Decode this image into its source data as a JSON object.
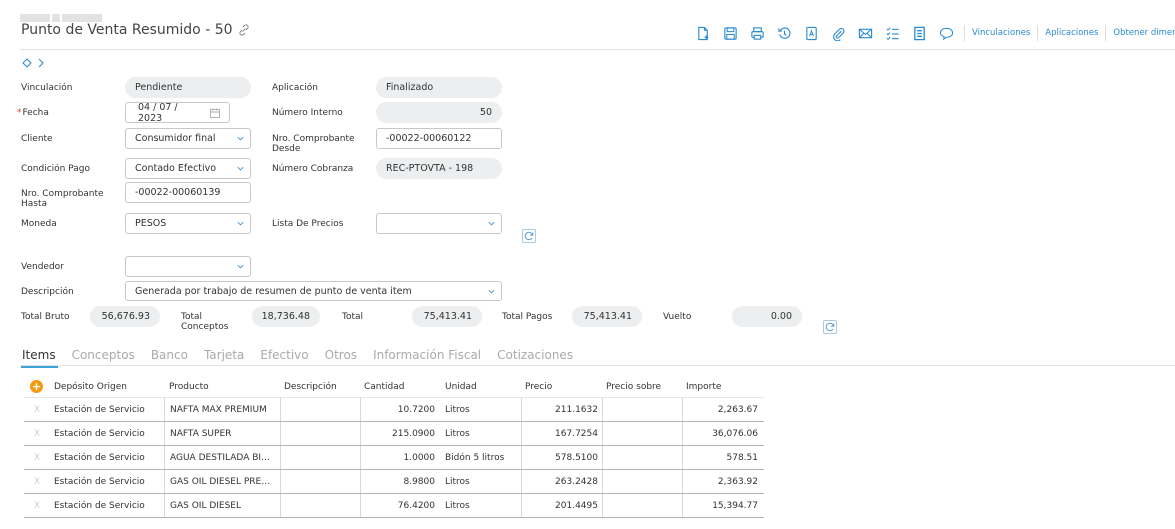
{
  "header": {
    "title": "Punto de Venta Resumido - 50",
    "toolbar_links": [
      "Vinculaciones",
      "Aplicaciones",
      "Obtener dimensiones"
    ]
  },
  "form": {
    "vinculacion": {
      "label": "Vinculación",
      "value": "Pendiente"
    },
    "aplicacion": {
      "label": "Aplicación",
      "value": "Finalizado"
    },
    "fecha": {
      "label": "Fecha",
      "required_mark": "*",
      "value": "04 / 07 / 2023"
    },
    "numero_interno": {
      "label": "Número Interno",
      "value": "50"
    },
    "cliente": {
      "label": "Cliente",
      "value": "Consumidor final"
    },
    "nro_desde": {
      "label": "Nro. Comprobante Desde",
      "value": "-00022-00060122"
    },
    "condicion_pago": {
      "label": "Condición Pago",
      "value": "Contado Efectivo"
    },
    "numero_cobranza": {
      "label": "Número Cobranza",
      "value": "REC-PTOVTA - 198"
    },
    "nro_hasta": {
      "label": "Nro. Comprobante Hasta",
      "value": "-00022-00060139"
    },
    "moneda": {
      "label": "Moneda",
      "value": "PESOS"
    },
    "lista_precios": {
      "label": "Lista De Precios",
      "value": ""
    },
    "vendedor": {
      "label": "Vendedor",
      "value": ""
    },
    "descripcion": {
      "label": "Descripción",
      "value": "Generada por trabajo de resumen de punto de venta item"
    }
  },
  "totals": {
    "total_bruto": {
      "label": "Total Bruto",
      "value": "56,676.93"
    },
    "total_conceptos": {
      "label": "Total Conceptos",
      "value": "18,736.48"
    },
    "total": {
      "label": "Total",
      "value": "75,413.41"
    },
    "total_pagos": {
      "label": "Total Pagos",
      "value": "75,413.41"
    },
    "vuelto": {
      "label": "Vuelto",
      "value": "0.00"
    }
  },
  "tabs": [
    "Items",
    "Conceptos",
    "Banco",
    "Tarjeta",
    "Efectivo",
    "Otros",
    "Información Fiscal",
    "Cotizaciones"
  ],
  "grid": {
    "columns": [
      "Depósito Origen",
      "Producto",
      "Descripción",
      "Cantidad",
      "Unidad",
      "Precio",
      "Precio sobre",
      "Importe"
    ],
    "delete_glyph": "X",
    "rows": [
      {
        "deposito": "Estación de Servicio",
        "producto": "NAFTA MAX PREMIUM",
        "descripcion": "",
        "cantidad": "10.7200",
        "unidad": "Litros",
        "precio": "211.1632",
        "precio_sobre": "",
        "importe": "2,263.67"
      },
      {
        "deposito": "Estación de Servicio",
        "producto": "NAFTA SUPER",
        "descripcion": "",
        "cantidad": "215.0900",
        "unidad": "Litros",
        "precio": "167.7254",
        "precio_sobre": "",
        "importe": "36,076.06"
      },
      {
        "deposito": "Estación de Servicio",
        "producto": "AGUA DESTILADA BI…",
        "descripcion": "",
        "cantidad": "1.0000",
        "unidad": "Bidón 5 litros",
        "precio": "578.5100",
        "precio_sobre": "",
        "importe": "578.51"
      },
      {
        "deposito": "Estación de Servicio",
        "producto": "GAS OIL DIESEL PRE…",
        "descripcion": "",
        "cantidad": "8.9800",
        "unidad": "Litros",
        "precio": "263.2428",
        "precio_sobre": "",
        "importe": "2,363.92"
      },
      {
        "deposito": "Estación de Servicio",
        "producto": "GAS OIL DIESEL",
        "descripcion": "",
        "cantidad": "76.4200",
        "unidad": "Litros",
        "precio": "201.4495",
        "precio_sobre": "",
        "importe": "15,394.77"
      }
    ]
  },
  "icons": {
    "toolbar": [
      "new-document-icon",
      "save-icon",
      "print-icon",
      "history-icon",
      "pdf-icon",
      "attach-icon",
      "mail-icon",
      "checklist-icon",
      "notes-icon",
      "comment-icon"
    ],
    "accent_color": "#2a8ad0",
    "add_color": "#f39c12"
  }
}
